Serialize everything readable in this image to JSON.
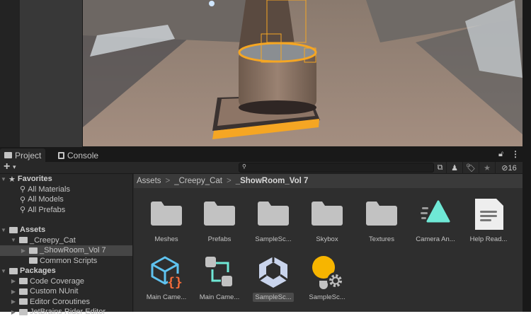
{
  "tabs": [
    {
      "label": "Project",
      "icon": "folder-icon"
    },
    {
      "label": "Console",
      "icon": "console-icon"
    }
  ],
  "toolbar": {
    "add_label": "+",
    "add_caret": "▾",
    "search_placeholder": "",
    "hidden_count": "16"
  },
  "tree": {
    "favorites": {
      "label": "Favorites",
      "items": [
        "All Materials",
        "All Models",
        "All Prefabs"
      ]
    },
    "assets": {
      "label": "Assets",
      "children": [
        {
          "label": "_Creepy_Cat",
          "children": [
            "_ShowRoom_Vol 7",
            "Common Scripts"
          ]
        }
      ]
    },
    "packages": {
      "label": "Packages",
      "items": [
        "Code Coverage",
        "Custom NUnit",
        "Editor Coroutines",
        "JetBrains Rider Editor"
      ]
    }
  },
  "breadcrumb": [
    "Assets",
    "_Creepy_Cat",
    "_ShowRoom_Vol 7"
  ],
  "breadcrumb_sep": ">",
  "assets": [
    {
      "label": "Meshes",
      "type": "folder"
    },
    {
      "label": "Prefabs",
      "type": "folder"
    },
    {
      "label": "SampleSc...",
      "type": "folder"
    },
    {
      "label": "Skybox",
      "type": "folder"
    },
    {
      "label": "Textures",
      "type": "folder"
    },
    {
      "label": "Camera An...",
      "type": "animation"
    },
    {
      "label": "Help Read...",
      "type": "text"
    },
    {
      "label": "Main Came...",
      "type": "script"
    },
    {
      "label": "Main Came...",
      "type": "graph"
    },
    {
      "label": "SampleSc...",
      "type": "scene",
      "selected": true
    },
    {
      "label": "SampleSc...",
      "type": "lighting"
    }
  ],
  "colors": {
    "accent_orange": "#f5a623",
    "teal": "#6fe8d6",
    "blue": "#5fc3f0",
    "code_orange": "#f26b3a",
    "yellow": "#f7b500"
  }
}
